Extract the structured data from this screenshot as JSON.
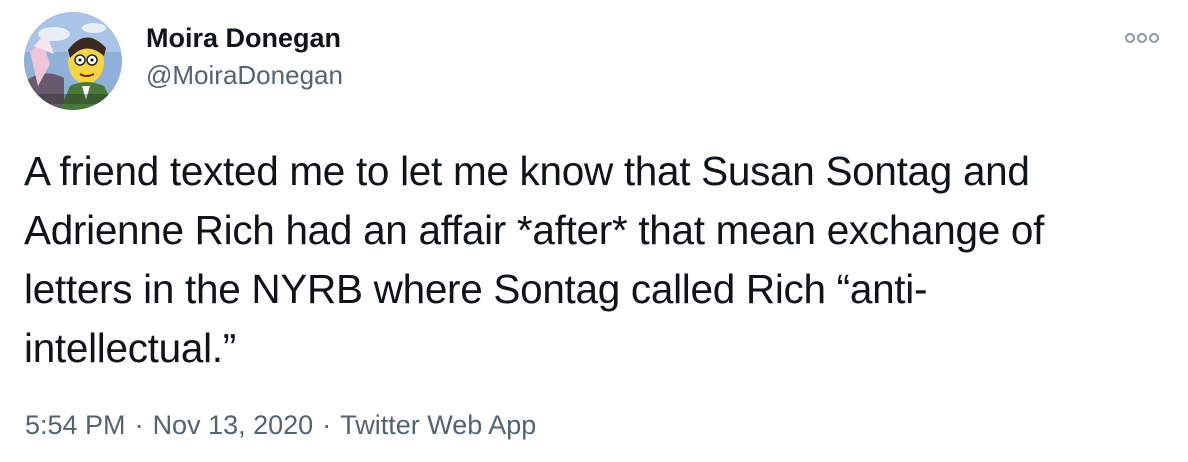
{
  "author": {
    "display_name": "Moira Donegan",
    "handle": "@MoiraDonegan",
    "avatar_icon": "cartoon-avatar"
  },
  "more_icon": "more-options-icon",
  "tweet": {
    "lines": [
      "A friend texted me to let me know that Susan Sontag and",
      "Adrienne Rich had an affair *after* that mean exchange of",
      "letters in the NYRB where Sontag called Rich “anti-",
      "intellectual.”"
    ]
  },
  "meta": {
    "time": "5:54 PM",
    "separator": "·",
    "date": "Nov 13, 2020",
    "source": "Twitter Web App"
  },
  "colors": {
    "text": "#0f1419",
    "secondary": "#536471",
    "avatar_bg": "#7d9ec9"
  }
}
